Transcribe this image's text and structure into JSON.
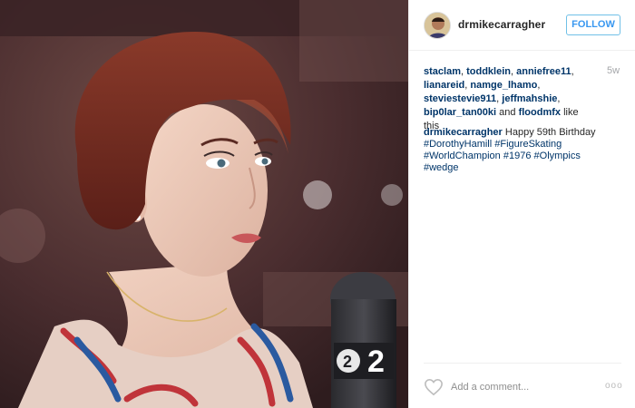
{
  "post": {
    "username": "drmikecarragher",
    "follow_label": "FOLLOW",
    "age": "5w",
    "likers": [
      "staclam",
      "toddklein",
      "anniefree11",
      "lianareid",
      "namge_lhamo",
      "steviestevie911",
      "jeffmahshie",
      "bip0lar_tan00ki",
      "floodmfx"
    ],
    "likes_and": "and",
    "likes_suffix": "like this",
    "caption": {
      "author": "drmikecarragher",
      "text": "Happy 59th Birthday",
      "hashtags": [
        "#DorothyHamill",
        "#FigureSkating",
        "#WorldChampion",
        "#1976",
        "#Olympics",
        "#wedge"
      ]
    },
    "comment_placeholder": "Add a comment...",
    "more_label": "ooo"
  },
  "photo": {
    "mic_flag_text": "2"
  },
  "colors": {
    "link": "#003569",
    "follow": "#3897f0",
    "hair": "#7a2f22",
    "background": "#4b2c2f"
  }
}
